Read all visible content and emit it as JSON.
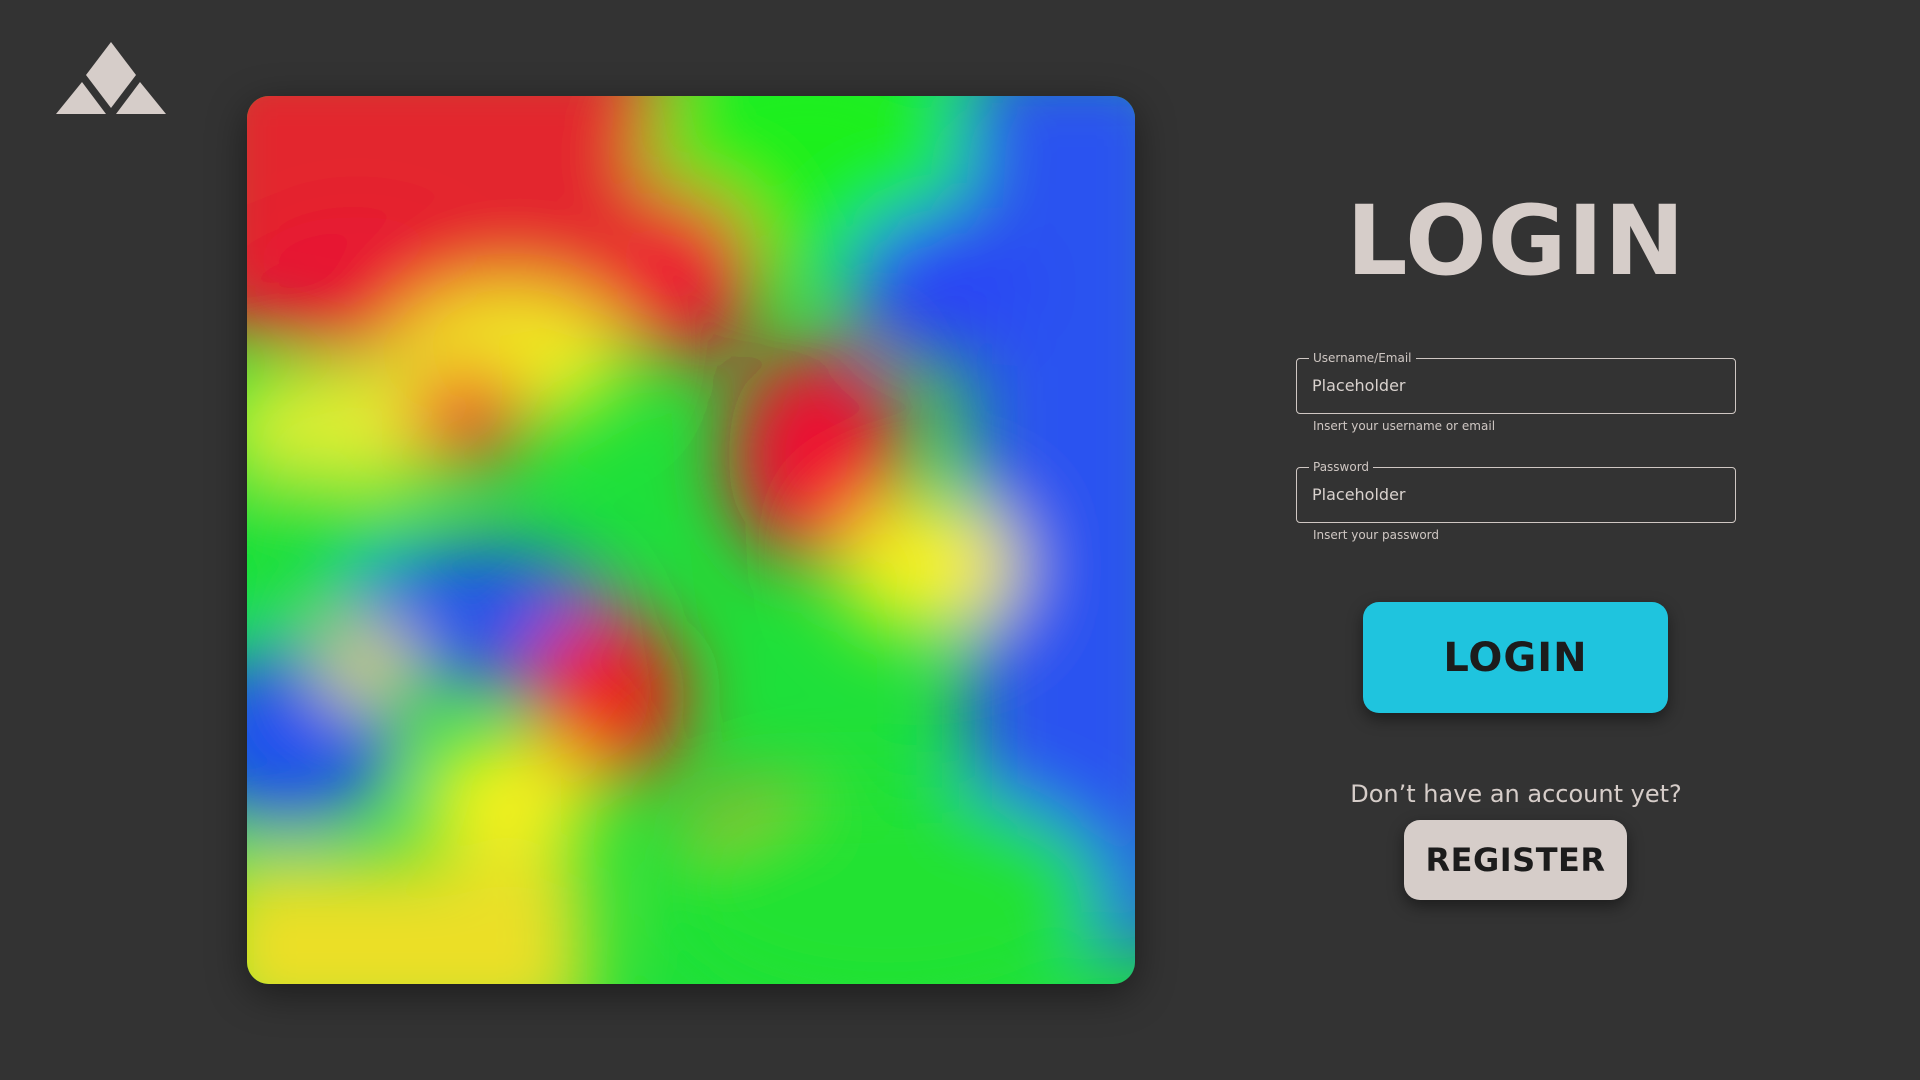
{
  "logo": {
    "icon": "triangles-logo-icon",
    "color": "#d6cdc9"
  },
  "hero": {
    "description_icon": "blurred-gradient-image"
  },
  "login_form": {
    "title": "LOGIN",
    "username": {
      "label": "Username/Email",
      "value": "Placeholder",
      "helper": "Insert your username or email"
    },
    "password": {
      "label": "Password",
      "value": "Placeholder",
      "helper": "Insert your password"
    },
    "login_button": "LOGIN",
    "register_prompt": "Don’t have an account yet?",
    "register_button": "REGISTER"
  },
  "colors": {
    "background": "#333333",
    "accent": "#1fc4de",
    "light": "#d6cdc9"
  }
}
